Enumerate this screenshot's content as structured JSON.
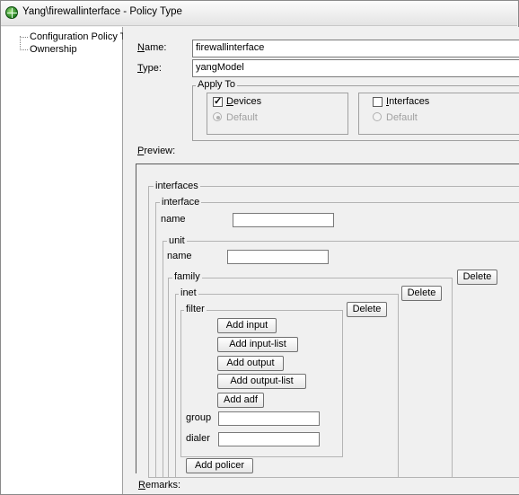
{
  "window": {
    "title": "Yang\\firewallinterface - Policy Type"
  },
  "tree": {
    "items": [
      "Configuration Policy Type",
      "Ownership"
    ]
  },
  "form": {
    "name_label": "Name:",
    "name_value": "firewallinterface",
    "type_label": "Type:",
    "type_value": "yangModel",
    "apply_to_label": "Apply To",
    "devices_label": "Devices",
    "devices_checked": true,
    "devices_default_label": "Default",
    "interfaces_label": "Interfaces",
    "interfaces_checked": false,
    "interfaces_default_label": "Default",
    "preview_label": "Preview:",
    "remarks_label": "Remarks:"
  },
  "preview": {
    "interfaces_label": "interfaces",
    "interface_label": "interface",
    "interface_name_label": "name",
    "unit_label": "unit",
    "unit_name_label": "name",
    "family_label": "family",
    "family_delete_label": "Delete",
    "inet_label": "inet",
    "inet_delete_label": "Delete",
    "filter_label": "filter",
    "filter_delete_label": "Delete",
    "buttons": [
      "Add input",
      "Add input-list",
      "Add output",
      "Add output-list",
      "Add adf"
    ],
    "group_label": "group",
    "dialer_label": "dialer",
    "add_policer_label": "Add policer"
  }
}
